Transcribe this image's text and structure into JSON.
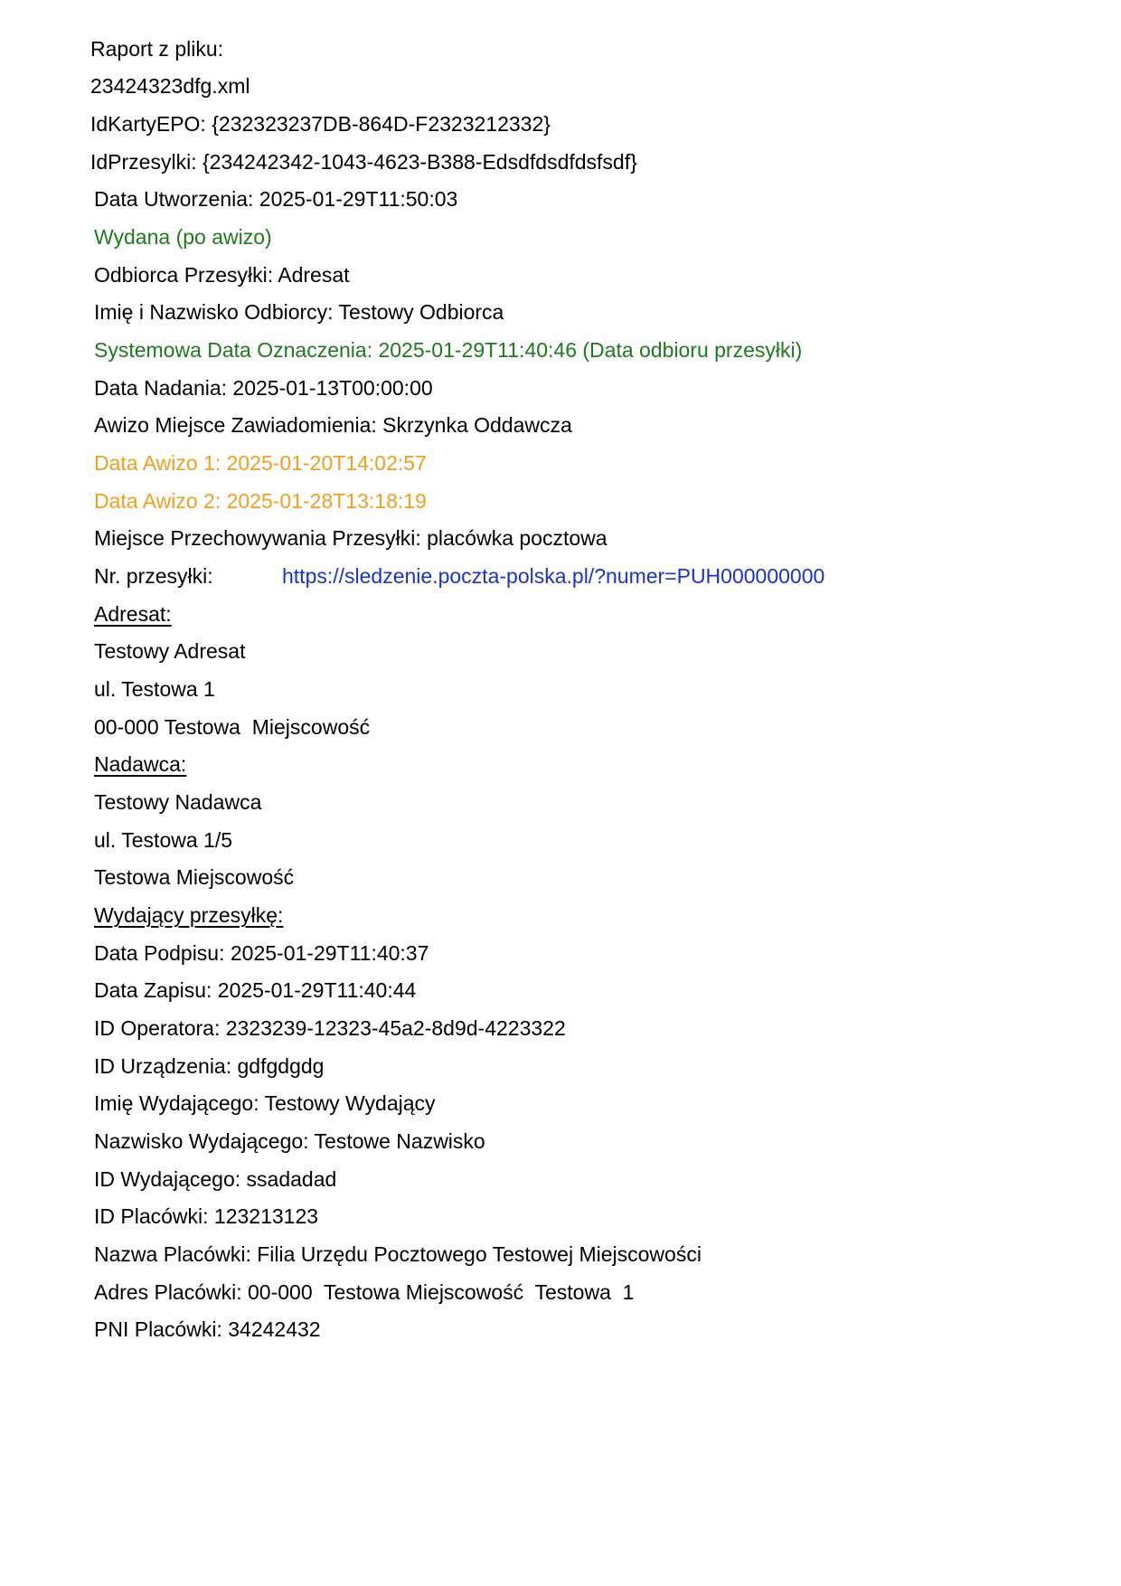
{
  "report": {
    "title": "Raport z pliku:",
    "filename": "23424323dfg.xml",
    "id_karty": "IdKartyEPO: {232323237DB-864D-F2323212332}",
    "id_przesylki": "IdPrzesylki: {234242342-1043-4623-B388-Edsdfdsdfdsfsdf}"
  },
  "details": {
    "data_utworzenia": "Data Utworzenia: 2025-01-29T11:50:03",
    "status": "Wydana (po awizo)",
    "odbiorca": "Odbiorca Przesyłki: Adresat",
    "imie_odbiorcy": "Imię i Nazwisko Odbiorcy: Testowy Odbiorca",
    "systemowa_data": "Systemowa Data Oznaczenia: 2025-01-29T11:40:46 (Data odbioru przesyłki)",
    "data_nadania": "Data Nadania: 2025-01-13T00:00:00",
    "awizo_miejsce": "Awizo Miejsce Zawiadomienia: Skrzynka Oddawcza",
    "data_awizo_1": "Data Awizo 1: 2025-01-20T14:02:57",
    "data_awizo_2": "Data Awizo 2: 2025-01-28T13:18:19",
    "miejsce_przechowywania": "Miejsce Przechowywania Przesyłki: placówka pocztowa",
    "nr_przesylki_label": "Nr. przesyłki:",
    "nr_przesylki_link": "https://sledzenie.poczta-polska.pl/?numer=PUH000000000"
  },
  "adresat": {
    "heading": "Adresat:",
    "name": "Testowy Adresat",
    "street": "ul. Testowa 1",
    "city": "00-000 Testowa  Miejscowość"
  },
  "nadawca": {
    "heading": "Nadawca:",
    "name": "Testowy Nadawca",
    "street": "ul. Testowa 1/5",
    "city": "Testowa Miejscowość"
  },
  "wydajacy": {
    "heading": "Wydający przesyłkę:",
    "data_podpisu": "Data Podpisu: 2025-01-29T11:40:37",
    "data_zapisu": "Data Zapisu: 2025-01-29T11:40:44",
    "id_operatora": "ID Operatora: 2323239-12323-45a2-8d9d-4223322",
    "id_urzadzenia": "ID Urządzenia: gdfgdgdg",
    "imie": "Imię Wydającego: Testowy Wydający",
    "nazwisko": "Nazwisko Wydającego: Testowe Nazwisko",
    "id_wydajacego": "ID Wydającego: ssadadad",
    "id_placowki": "ID Placówki: 123213123",
    "nazwa_placowki": "Nazwa Placówki: Filia Urzędu Pocztowego Testowej Miejscowości",
    "adres_placowki": "Adres Placówki: 00-000  Testowa Miejscowość  Testowa  1",
    "pni_placowki": "PNI Placówki: 34242432"
  },
  "colors": {
    "green": "#1f7a1f",
    "orange": "#f0a020",
    "link": "#1a33cc"
  }
}
